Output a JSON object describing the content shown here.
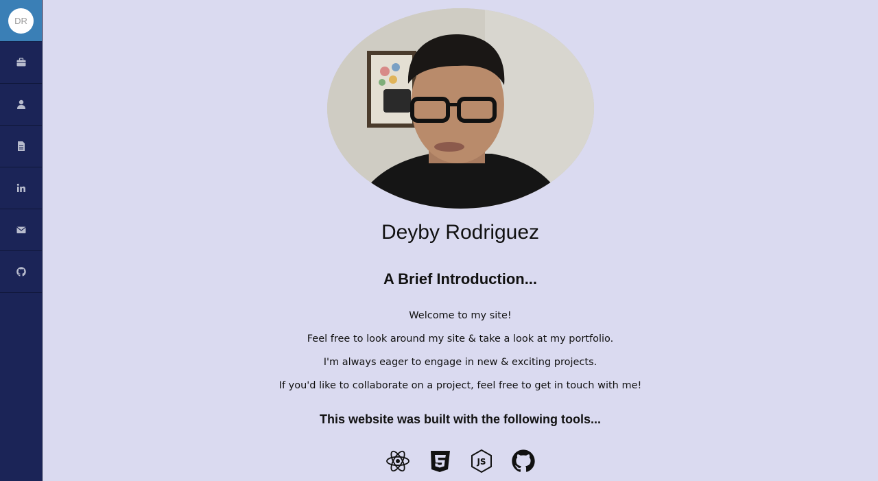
{
  "sidebar": {
    "brand_initials": "DR",
    "items": [
      {
        "icon": "briefcase-icon"
      },
      {
        "icon": "user-icon"
      },
      {
        "icon": "document-icon"
      },
      {
        "icon": "linkedin-icon"
      },
      {
        "icon": "envelope-icon"
      },
      {
        "icon": "github-icon"
      }
    ]
  },
  "profile": {
    "name": "Deyby Rodriguez",
    "heading": "A Brief Introduction...",
    "paragraphs": [
      "Welcome to my site!",
      "Feel free to look around my site & take a look at my portfolio.",
      "I'm always eager to engage in new & exciting projects.",
      "If you'd like to collaborate on a project, feel free to get in touch with me!"
    ]
  },
  "tools": {
    "heading": "This website was built with the following tools...",
    "icons": [
      "react-icon",
      "css3-icon",
      "nodejs-icon",
      "github-icon"
    ]
  },
  "colors": {
    "page_bg": "#dadaf0",
    "sidebar_bg": "#1b2457",
    "brand_bg": "#3a7fb6"
  }
}
